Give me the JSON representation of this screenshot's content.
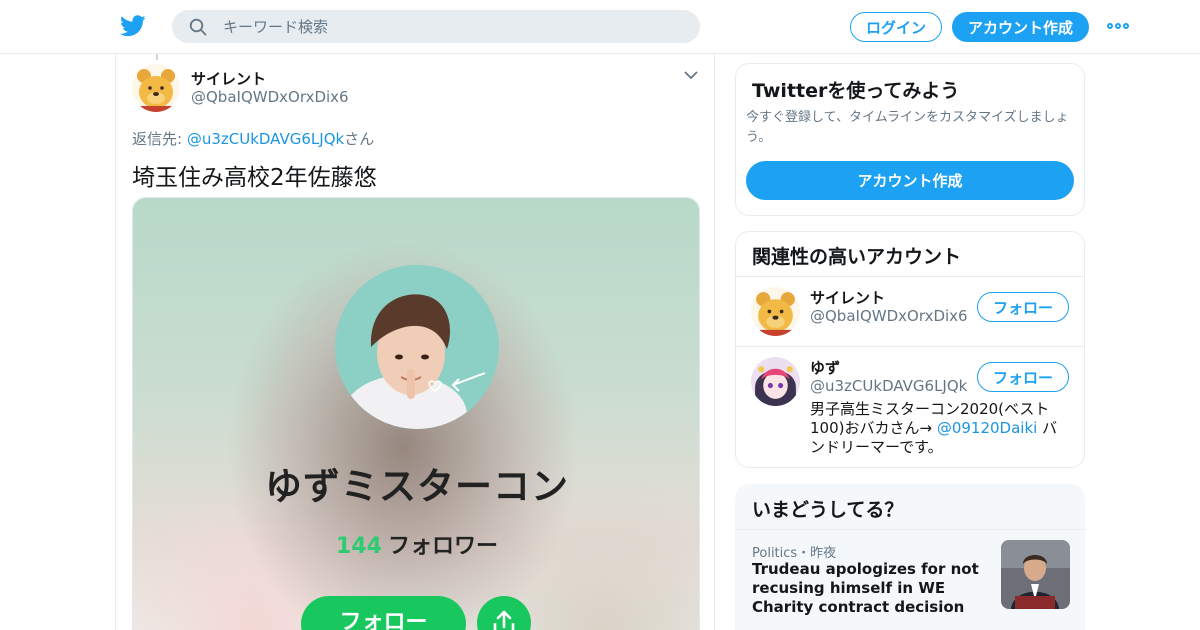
{
  "header": {
    "search_placeholder": "キーワード検索",
    "login_label": "ログイン",
    "signup_label": "アカウント作成"
  },
  "tweet": {
    "author_name": "サイレント",
    "author_handle": "@QbaIQWDxOrxDix6",
    "reply_prefix": "返信先: ",
    "reply_to": "@u3zCUkDAVG6LJQk",
    "reply_suffix": "さん",
    "text": "埼玉住み高校2年佐藤悠",
    "card": {
      "title": "ゆずミスターコン",
      "followers_count": "144",
      "followers_label": "フォロワー",
      "follow_label": "フォロー"
    }
  },
  "sidebar": {
    "signup": {
      "title": "Twitterを使ってみよう",
      "description": "今すぐ登録して、タイムラインをカスタマイズしましょう。",
      "button_label": "アカウント作成"
    },
    "related": {
      "title": "関連性の高いアカウント",
      "accounts": [
        {
          "name": "サイレント",
          "handle": "@QbaIQWDxOrxDix6",
          "follow_label": "フォロー"
        },
        {
          "name": "ゆず",
          "handle": "@u3zCUkDAVG6LJQk",
          "follow_label": "フォロー",
          "bio_before": "男子高生ミスターコン2020(ベスト100)おバカさん→ ",
          "bio_link": "@09120Daiki",
          "bio_after": " バンドリーマーです。"
        }
      ]
    },
    "trends": {
      "title": "いまどうしてる？",
      "items": [
        {
          "meta": "Politics・昨夜",
          "title": "Trudeau apologizes for not recusing himself in WE Charity contract decision"
        }
      ]
    }
  },
  "colors": {
    "twitter_blue": "#1da1f2",
    "link_blue": "#1b95e0",
    "card_green": "#18c75e",
    "followers_green": "#2ecc71"
  }
}
